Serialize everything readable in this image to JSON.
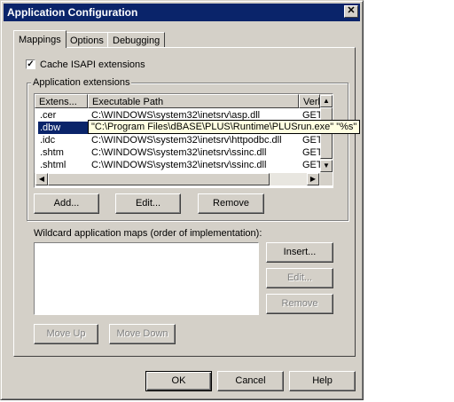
{
  "window": {
    "title": "Application Configuration",
    "close_glyph": "✕"
  },
  "tabs": [
    {
      "label": "Mappings",
      "active": true
    },
    {
      "label": "Options",
      "active": false
    },
    {
      "label": "Debugging",
      "active": false
    }
  ],
  "cache_isapi": {
    "label": "Cache ISAPI extensions",
    "checked": true,
    "check_glyph": "✓"
  },
  "app_extensions": {
    "group_label": "Application extensions",
    "columns": [
      "Extens...",
      "Executable Path",
      "Verl"
    ],
    "rows": [
      {
        "ext": ".cer",
        "path": "C:\\WINDOWS\\system32\\inetsrv\\asp.dll",
        "verb": "GET"
      },
      {
        "ext": ".dbw",
        "path": "",
        "verb": "",
        "selected": true
      },
      {
        "ext": ".idc",
        "path": "C:\\WINDOWS\\system32\\inetsrv\\httpodbc.dll",
        "verb": "GET"
      },
      {
        "ext": ".shtm",
        "path": "C:\\WINDOWS\\system32\\inetsrv\\ssinc.dll",
        "verb": "GET"
      },
      {
        "ext": ".shtml",
        "path": "C:\\WINDOWS\\system32\\inetsrv\\ssinc.dll",
        "verb": "GET"
      }
    ],
    "tooltip": "\"C:\\Program Files\\dBASE\\PLUS\\Runtime\\PLUSrun.exe\" \"%s\""
  },
  "ext_buttons": {
    "add": "Add...",
    "edit": "Edit...",
    "remove": "Remove"
  },
  "wildcard": {
    "label": "Wildcard application maps (order of implementation):",
    "insert": "Insert...",
    "edit": "Edit...",
    "remove": "Remove"
  },
  "move": {
    "up": "Move Up",
    "down": "Move Down"
  },
  "dialog_buttons": {
    "ok": "OK",
    "cancel": "Cancel",
    "help": "Help"
  },
  "scroll_glyphs": {
    "up": "▲",
    "down": "▼",
    "left": "◀",
    "right": "▶"
  }
}
